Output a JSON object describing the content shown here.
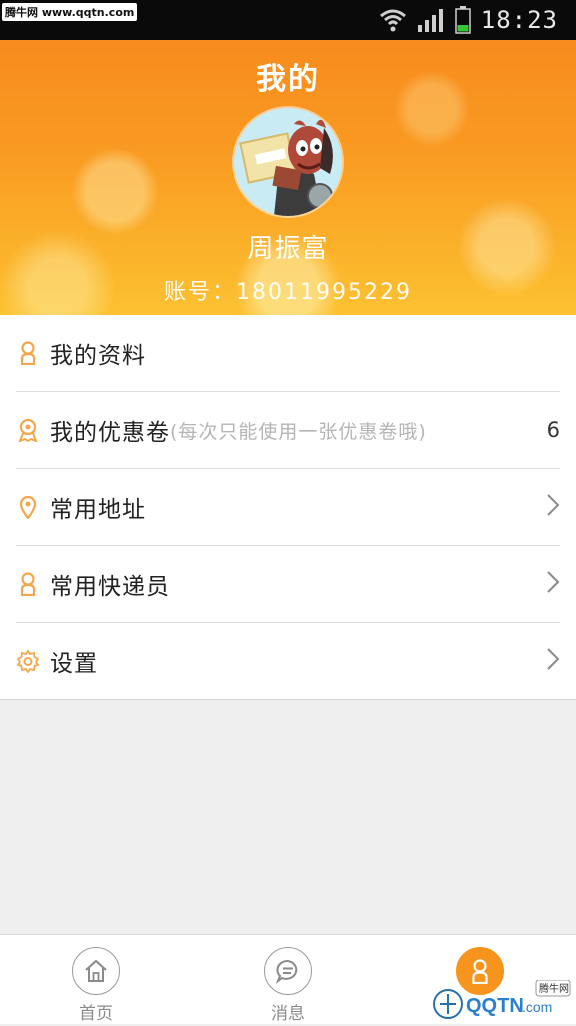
{
  "status_bar": {
    "watermark": "腾牛网 www.qqtn.com",
    "time": "18:23"
  },
  "header": {
    "title": "我的",
    "user_name": "周振富",
    "account_label": "账号：",
    "account_number": "18011995229"
  },
  "menu": {
    "items": [
      {
        "label": "我的资料",
        "icon": "person-icon",
        "note": "",
        "right": "",
        "chevron": false
      },
      {
        "label": "我的优惠卷",
        "icon": "badge-icon",
        "note": "(每次只能使用一张优惠卷哦)",
        "right": "6",
        "chevron": false
      },
      {
        "label": "常用地址",
        "icon": "location-pin-icon",
        "note": "",
        "right": "",
        "chevron": true
      },
      {
        "label": "常用快递员",
        "icon": "person-icon",
        "note": "",
        "right": "",
        "chevron": true
      },
      {
        "label": "设置",
        "icon": "gear-icon",
        "note": "",
        "right": "",
        "chevron": true
      }
    ]
  },
  "bottom_nav": {
    "items": [
      {
        "label": "首页",
        "icon": "home-icon",
        "active": false
      },
      {
        "label": "消息",
        "icon": "chat-bubble-icon",
        "active": false
      },
      {
        "label": "",
        "icon": "person-icon",
        "active": true
      }
    ]
  },
  "watermark_logo": {
    "text": "QQTN",
    "suffix": ".com",
    "tag": "腾牛网"
  },
  "colors": {
    "accent": "#f7941d",
    "icon_orange": "#f5a64a",
    "divider": "#dddddd"
  }
}
